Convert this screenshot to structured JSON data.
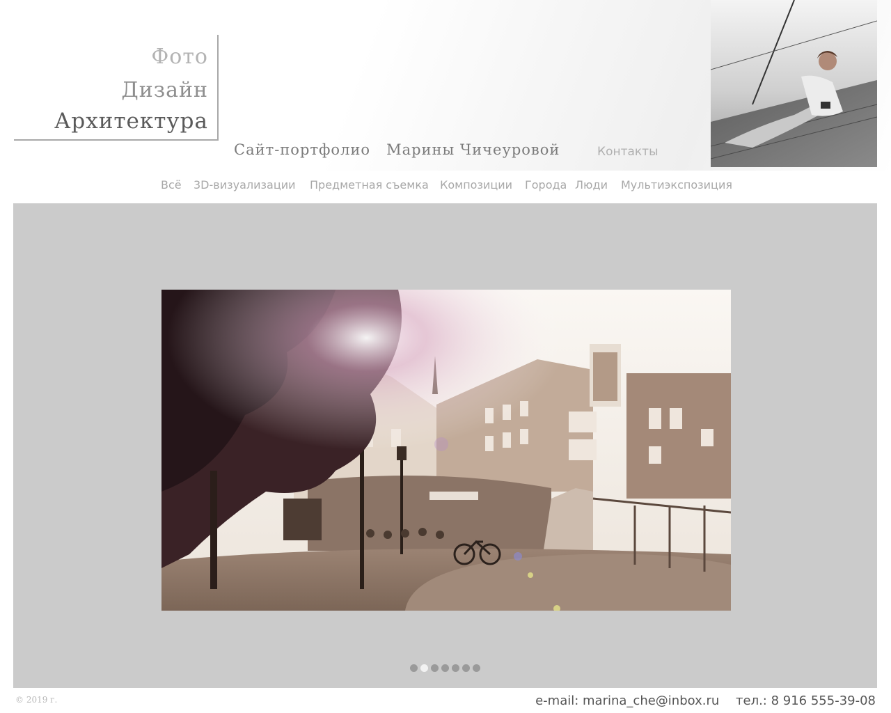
{
  "brand": {
    "line1": "Фото",
    "line2": "Дизайн",
    "line3": "Архитектура"
  },
  "header": {
    "tagline": "Сайт-портфолио   Марины Чичеуровой",
    "contacts_link": "Контакты"
  },
  "nav": {
    "items": [
      {
        "label": "Всё"
      },
      {
        "label": "3D-визуализации"
      },
      {
        "label": "Предметная съемка"
      },
      {
        "label": "Композиции"
      },
      {
        "label": "Города"
      },
      {
        "label": "Люди"
      },
      {
        "label": "Мультиэкспозиция"
      }
    ]
  },
  "slider": {
    "slide_count": 7,
    "active_index": 1
  },
  "footer": {
    "copyright": "© 2019 г.",
    "email": "e-mail: marina_che@inbox.ru",
    "phone": "тел.: 8 916 555-39-08"
  },
  "colors": {
    "gallery_bg": "#cbcbcb",
    "nav_text": "#a8a8a8",
    "footer_text": "#555555"
  }
}
